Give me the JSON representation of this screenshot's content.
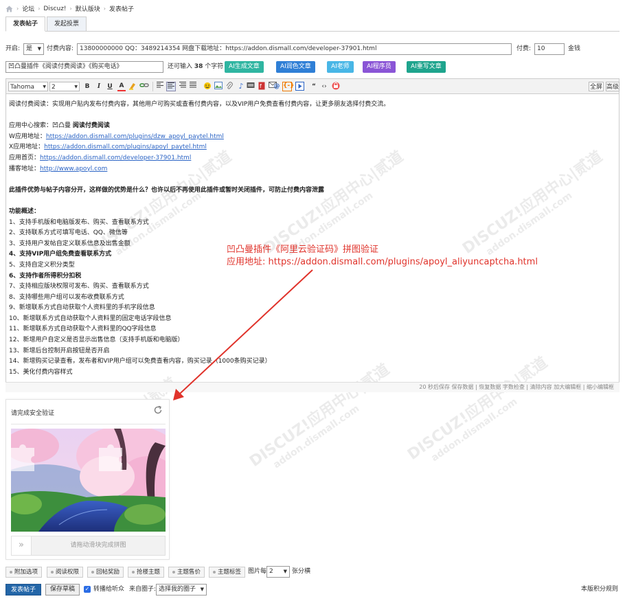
{
  "breadcrumb": {
    "items": [
      "论坛",
      "Discuz!",
      "默认版块",
      "发表帖子"
    ]
  },
  "tabs": [
    "发表帖子",
    "发起投票"
  ],
  "row1": {
    "enable_label": "开启:",
    "enable_value": "是",
    "paid_content_label": "付费内容:",
    "paid_content_value": "13800000000  QQ：3489214354 网盘下载地址：https://addon.dismall.com/developer-37901.html",
    "fee_label": "付费:",
    "fee_value": "10",
    "currency": "金钱"
  },
  "title_row": {
    "title_value": "凹凸曼插件《阅读付费阅读》《购买电话》",
    "remaining_prefix": "还可输入",
    "remaining_count": "38",
    "remaining_suffix": "个字符",
    "ai_buttons": [
      {
        "label": "AI生成文章",
        "color": "#2fb5a1"
      },
      {
        "label": "AI润色文章",
        "color": "#2f7fd6"
      },
      {
        "label": "AI老师",
        "color": "#48b6e6"
      },
      {
        "label": "AI程序员",
        "color": "#8a55d6"
      },
      {
        "label": "AI重写文章",
        "color": "#1ea48d"
      }
    ]
  },
  "toolbar": {
    "font": "Tahoma",
    "size": "2",
    "fullscreen": "全屏",
    "advanced": "高级"
  },
  "content": {
    "intro": "阅读付费阅读：实现用户贴内发布付费内容，其他用户可购买或查看付费内容，以及VIP用户免费查看付费内容，让更多朋友选择付费交流。",
    "search_label": "应用中心搜索：凹凸曼",
    "search_bold": "阅读付费阅读",
    "w_label": "W应用地址：",
    "w_url": "https://addon.dismall.com/plugins/dzw_apoyl_paytel.html",
    "x_label": "X应用地址：",
    "x_url": "https://addon.dismall.com/plugins/apoyl_paytel.html",
    "home_label": "应用首页：",
    "home_url": "https://addon.dismall.com/developer-37901.html",
    "blog_label": "播客地址：",
    "blog_url": "http://www.apoyl.com",
    "advantage": "此插件优势与帖子内容分开，这样做的优势是什么？也许以后不再使用此插件或暂时关闭插件，可防止付费内容泄露",
    "features_title": "功能概述：",
    "features": [
      "1、支持手机版和电脑版发布、购买、查看联系方式",
      "2、支持联系方式可填写电话、QQ、微信等",
      "3、支持用户发帖自定义联系信息及出售金额",
      "4、支持VIP用户组免费查看联系方式",
      "5、支持自定义积分类型",
      "6、支持作者所得积分扣税",
      "7、支持相应版块权限可发布、购买、查看联系方式",
      "8、支持哪些用户组可以发布收费联系方式",
      "9、新增联系方式自动获取个人资料里的手机字段信息",
      "10、新增联系方式自动获取个人资料里的固定电话字段信息",
      "11、新增联系方式自动获取个人资料里的QQ字段信息",
      "12、新增用户自定义是否显示出售信息（支持手机版和电脑版）",
      "13、新增后台控制开启按钮是否开启",
      "14、新增购买记录查看，发布者和VIP用户组可以免费查看内容，购买记录（1000条购买记录）",
      "15、美化付费内容样式"
    ]
  },
  "statusbar": "20 秒后保存  保存数据 | 恢复数据     字数检查 | 清除内容     加大编辑框 | 缩小编辑框",
  "annotation": {
    "line1": "凹凸曼插件《阿里云验证码》拼图验证",
    "line2": "应用地址: https://addon.dismall.com/plugins/apoyl_aliyuncaptcha.html",
    "color": "#e0332b"
  },
  "captcha": {
    "title": "请完成安全验证",
    "slider_text": "请拖动滑块完成拼图",
    "slider_icon": "»"
  },
  "options": [
    "附加选项",
    "阅读权限",
    "回帖奖励",
    "抢楼主题",
    "主题售价",
    "主题标签"
  ],
  "images_per_row": {
    "label": "图片每",
    "value": "2",
    "suffix": "张分横"
  },
  "footer": {
    "submit": "发表帖子",
    "save_draft": "保存草稿",
    "notify_label": "转播给听众",
    "from_circle_label": "来自圈子:",
    "circle_select": "选择我的圈子",
    "rules": "本版积分规则"
  },
  "watermark": {
    "brand": "DISCUZ!应用中心|贰道",
    "domain": "addon.dismall.com"
  }
}
